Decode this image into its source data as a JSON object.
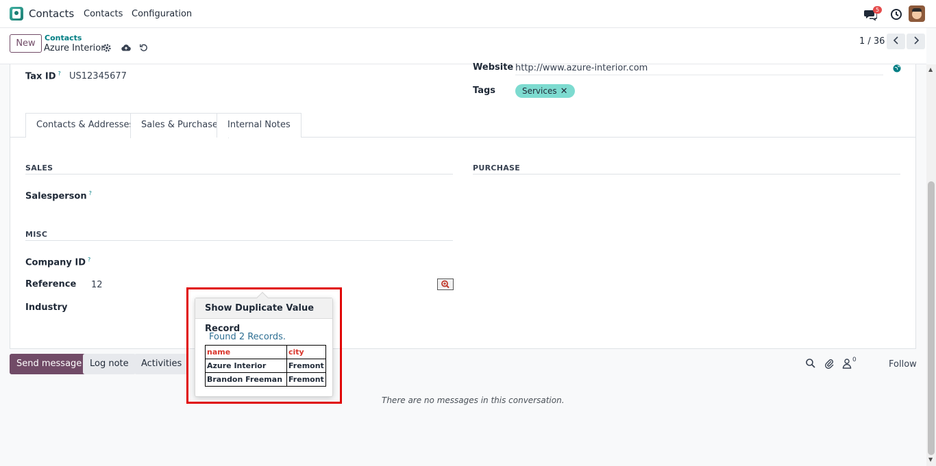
{
  "navbar": {
    "app_name": "Contacts",
    "menu": [
      "Contacts",
      "Configuration"
    ],
    "message_count": "5"
  },
  "control_panel": {
    "new_label": "New",
    "breadcrumb_parent": "Contacts",
    "breadcrumb_current": "Azure Interior",
    "pager": "1 / 36"
  },
  "form": {
    "tax_id_label": "Tax ID",
    "tax_id_value": "US12345677",
    "tooltip_marker": "?",
    "website_label": "Website",
    "website_value": "http://www.azure-interior.com",
    "tags_label": "Tags",
    "tags": [
      "Services"
    ],
    "tabs": [
      "Contacts & Addresses",
      "Sales & Purchase",
      "Internal Notes"
    ],
    "active_tab": "Sales & Purchase",
    "sales_title": "SALES",
    "purchase_title": "PURCHASE",
    "salesperson_label": "Salesperson",
    "misc_title": "MISC",
    "company_id_label": "Company ID",
    "reference_label": "Reference",
    "reference_value": "12",
    "industry_label": "Industry"
  },
  "popover": {
    "title": "Show Duplicate Value Record",
    "found_text": "Found 2 Records.",
    "columns": [
      "name",
      "city"
    ],
    "rows": [
      [
        "Azure Interior",
        "Fremont"
      ],
      [
        "Brandon Freeman",
        "Fremont"
      ]
    ]
  },
  "chatter": {
    "send_message": "Send message",
    "log_note": "Log note",
    "activities": "Activities",
    "follower_count": "0",
    "follow": "Follow",
    "empty_text": "There are no messages in this conversation."
  },
  "colors": {
    "brand": "#714b67",
    "teal": "#017e84",
    "tag": "#7ddbd0",
    "highlight": "#e00000"
  }
}
